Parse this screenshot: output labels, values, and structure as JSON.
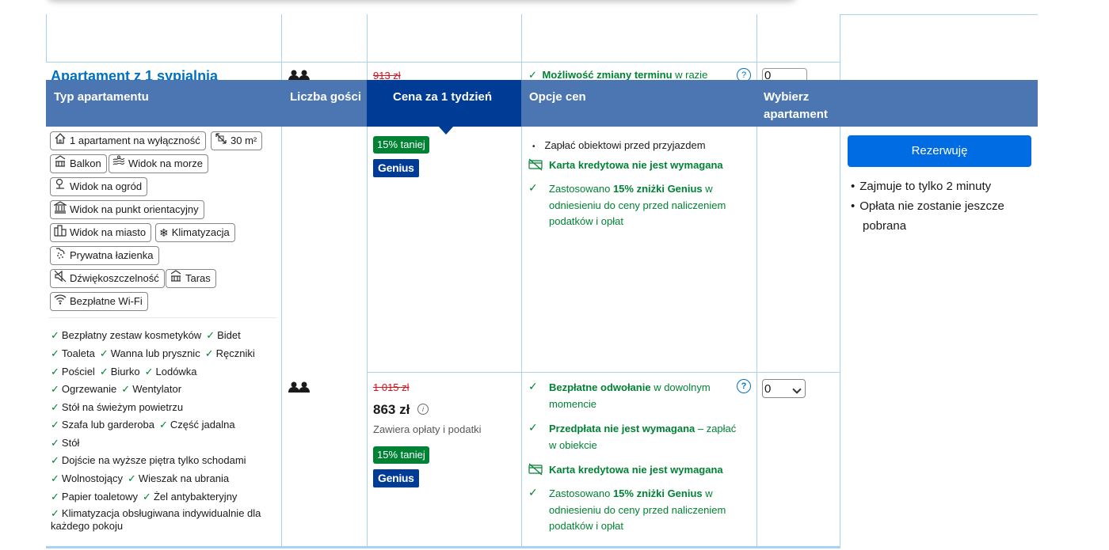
{
  "colors": {
    "header_bg": "#4c76b2",
    "header_active": "#003b95",
    "green": "#008234",
    "link_blue": "#0071c2",
    "price_red": "#d4111e",
    "button_blue": "#006ce4",
    "grid_line": "#a9d1f2"
  },
  "ghost_row": {
    "title": "Apartament z 1 sypialnią",
    "old_price": "913 zł",
    "option_bold": "Możliwość zmiany terminu",
    "option_rest": " w razie",
    "select_value": "0",
    "help": "?"
  },
  "table_header": {
    "col_type": "Typ apartamentu",
    "col_guests": "Liczba gości",
    "col_price": "Cena za 1 tydzień",
    "col_options": "Opcje cen",
    "col_select_line1": "Wybierz",
    "col_select_line2": "apartament"
  },
  "facilities": [
    {
      "label": "1 apartament na wyłączność",
      "icon": "house-icon"
    },
    {
      "label": "30 m²",
      "icon": "area-icon"
    },
    {
      "label": "Balkon",
      "icon": "balcony-icon"
    },
    {
      "label": "Widok na morze",
      "icon": "sea-view-icon"
    },
    {
      "label": "Widok na ogród",
      "icon": "garden-icon"
    },
    {
      "label": "Widok na punkt orientacyjny",
      "icon": "landmark-icon"
    },
    {
      "label": "Widok na miasto",
      "icon": "city-icon"
    },
    {
      "label": "Klimatyzacja",
      "icon": "snowflake-icon"
    },
    {
      "label": "Prywatna łazienka",
      "icon": "bath-icon"
    },
    {
      "label": "Dźwiękoszczelność",
      "icon": "soundproof-icon"
    },
    {
      "label": "Taras",
      "icon": "terrace-icon"
    },
    {
      "label": "Bezpłatne Wi-Fi",
      "icon": "wifi-icon"
    }
  ],
  "amenity_lines": [
    [
      "Bezpłatny zestaw kosmetyków",
      "Bidet"
    ],
    [
      "Toaleta",
      "Wanna lub prysznic",
      "Ręczniki"
    ],
    [
      "Pościel",
      "Biurko",
      "Lodówka"
    ],
    [
      "Ogrzewanie",
      "Wentylator"
    ],
    [
      "Stół na świeżym powietrzu"
    ],
    [
      "Szafa lub garderoba",
      "Część jadalna"
    ],
    [
      "Stół"
    ],
    [
      "Dojście na wyższe piętra tylko schodami"
    ],
    [
      "Wolnostojący",
      "Wieszak na ubrania"
    ],
    [
      "Papier toaletowy",
      "Żel antybakteryjny"
    ],
    [
      "Klimatyzacja obsługiwana indywidualnie dla"
    ]
  ],
  "amenity_continuation": "każdego pokoju",
  "row1": {
    "badge": "15% taniej",
    "genius": "Genius",
    "pay_at_property": "Zapłać obiektowi przed przyjazdem",
    "no_card": "Karta kredytowa nie jest wymagana",
    "discount_prefix": "Zastosowano ",
    "discount_bold": "15% zniżki Genius",
    "discount_rest1": " w",
    "discount_rest2": "odniesieniu do ceny przed naliczeniem",
    "discount_rest3": "podatków i opłat"
  },
  "row2": {
    "old_price": "1 015 zł",
    "price": "863 zł",
    "price_note": "Zawiera opłaty i podatki",
    "badge": "15% taniej",
    "genius": "Genius",
    "cancel_bold": "Bezpłatne odwołanie",
    "cancel_rest": " w dowolnym",
    "cancel_rest2": "momencie",
    "prepay_bold": "Przedpłata nie jest wymagana",
    "prepay_rest": " – zapłać",
    "prepay_rest2": "w obiekcie",
    "no_card": "Karta kredytowa nie jest wymagana",
    "discount_prefix": "Zastosowano ",
    "discount_bold": "15% zniżki Genius",
    "discount_rest1": " w",
    "discount_rest2": "odniesieniu do ceny przed naliczeniem",
    "discount_rest3": "podatków i opłat",
    "select_value": "0",
    "help": "?"
  },
  "reserve": {
    "button": "Rezerwuję",
    "bullets": [
      "Zajmuje to tylko 2 minuty",
      "Opłata nie zostanie jeszcze",
      "pobrana"
    ]
  }
}
